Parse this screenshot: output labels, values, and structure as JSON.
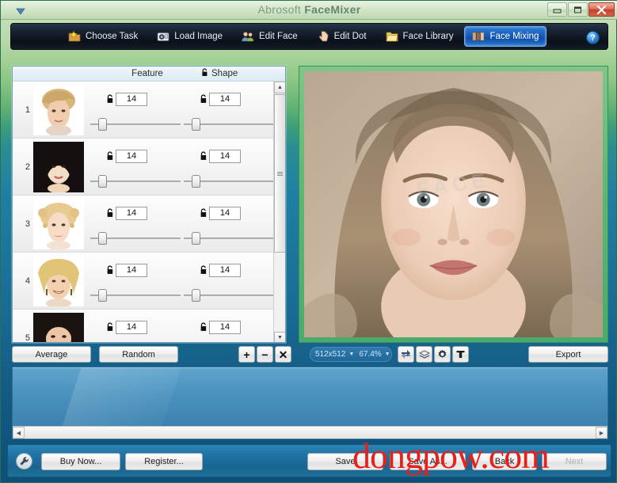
{
  "window": {
    "title_prefix": "Abrosoft ",
    "title_bold": "FaceMixer",
    "menu_icon": "chevron-down-icon",
    "buttons": {
      "minimize": "–",
      "maximize": "❐",
      "close": "✕"
    }
  },
  "toolbar": {
    "items": [
      {
        "label": "Choose Task",
        "icon": "star-folder-icon",
        "active": false
      },
      {
        "label": "Load Image",
        "icon": "camera-icon",
        "active": false
      },
      {
        "label": "Edit Face",
        "icon": "people-icon",
        "active": false
      },
      {
        "label": "Edit Dot",
        "icon": "hand-pointer-icon",
        "active": false
      },
      {
        "label": "Face Library",
        "icon": "folder-icon",
        "active": false
      },
      {
        "label": "Face Mixing",
        "icon": "faces-mix-icon",
        "active": true
      }
    ],
    "help_label": "?"
  },
  "list_panel": {
    "headers": {
      "feature": "Feature",
      "shape": "Shape",
      "shape_lock_icon": "open-padlock-icon"
    },
    "rows": [
      {
        "index": "1",
        "thumb": "blonde-short-hair-woman",
        "feature_value": "14",
        "shape_value": "14",
        "feature_lock": "open-padlock-icon",
        "shape_lock": "open-padlock-icon"
      },
      {
        "index": "2",
        "thumb": "dark-hair-asian-woman",
        "feature_value": "14",
        "shape_value": "14",
        "feature_lock": "open-padlock-icon",
        "shape_lock": "open-padlock-icon"
      },
      {
        "index": "3",
        "thumb": "curly-blonde-red-lips-woman",
        "feature_value": "14",
        "shape_value": "14",
        "feature_lock": "open-padlock-icon",
        "shape_lock": "open-padlock-icon"
      },
      {
        "index": "4",
        "thumb": "smiling-blonde-woman",
        "feature_value": "14",
        "shape_value": "14",
        "feature_lock": "open-padlock-icon",
        "shape_lock": "open-padlock-icon"
      },
      {
        "index": "5",
        "thumb": "dark-hair-woman",
        "feature_value": "14",
        "shape_value": "14",
        "feature_lock": "open-padlock-icon",
        "shape_lock": "open-padlock-icon"
      }
    ],
    "scrollbar": {
      "up": "▲",
      "down": "▼"
    }
  },
  "preview": {
    "alt": "blended-composite-face",
    "watermark": "FACE"
  },
  "mid_bar": {
    "average_label": "Average",
    "random_label": "Random",
    "add_label": "+",
    "remove_label": "−",
    "clear_label": "✕",
    "size_value": "512x512",
    "zoom_value": "67.4%",
    "caret": "▼",
    "flip_icon": "flip-rotate-icon",
    "layers_icon": "layers-icon",
    "settings_icon": "gear-icon",
    "text_icon": "text-tool-icon",
    "export_label": "Export"
  },
  "lower_panel": {
    "scroll_left": "◀",
    "scroll_right": "▶"
  },
  "bottom_bar": {
    "wrench_icon": "wrench-icon",
    "buy_now_label": "Buy Now...",
    "register_label": "Register...",
    "save_label": "Save",
    "save_as_label": "Save As...",
    "back_label": "Back",
    "next_label": "Next"
  },
  "watermark": {
    "text": "dongpow.com",
    "color": "#e8201b"
  }
}
